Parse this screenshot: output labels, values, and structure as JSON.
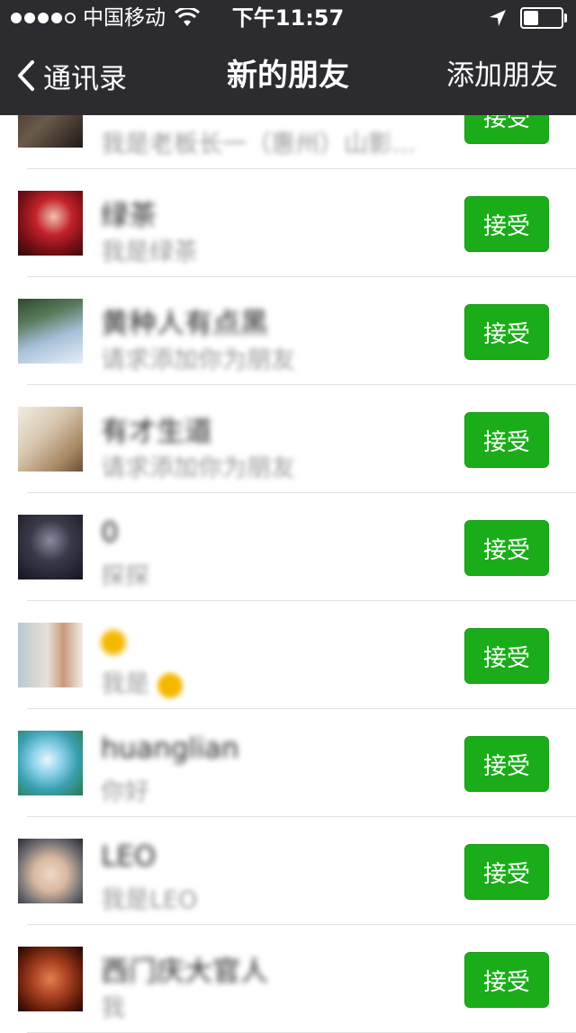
{
  "status_bar": {
    "carrier": "中国移动",
    "time": "下午11:57"
  },
  "nav": {
    "back_label": "通讯录",
    "title": "新的朋友",
    "right_action": "添加朋友"
  },
  "accept_label": "接受",
  "colors": {
    "accent_green": "#1aad19",
    "topbar_bg": "#2c2c30",
    "separator": "#e2e2e2"
  },
  "requests": [
    {
      "name": "",
      "message": "我是老板长一（惠州）山影...",
      "avatar": "avatar-photo"
    },
    {
      "name": "绿茶",
      "message": "我是绿茶",
      "avatar": "avatar-photo"
    },
    {
      "name": "黄种人有点黑",
      "message": "请求添加你为朋友",
      "avatar": "avatar-photo"
    },
    {
      "name": "有才生道",
      "message": "请求添加你为朋友",
      "avatar": "avatar-photo"
    },
    {
      "name": "0",
      "message": "探探",
      "avatar": "avatar-photo"
    },
    {
      "name": "",
      "message": "我是",
      "avatar": "avatar-photo"
    },
    {
      "name": "huanglian",
      "message": "你好",
      "avatar": "avatar-photo"
    },
    {
      "name": "LEO",
      "message": "我是LEO",
      "avatar": "avatar-photo"
    },
    {
      "name": "西门庆大官人",
      "message": "我",
      "avatar": "avatar-photo"
    }
  ]
}
